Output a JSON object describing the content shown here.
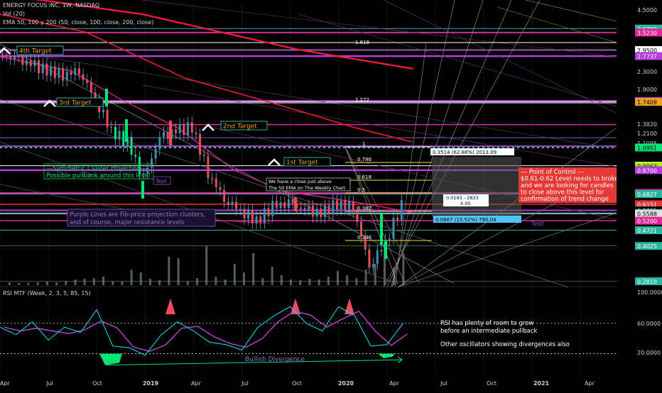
{
  "header": {
    "symbol_line": "ENERGY FOCUS INC, 1W, NASDAQ",
    "vol_line": "Vol (20)",
    "ema_line": "EMA 50, 100 y 200 (50, close, 100, close, 200, close)"
  },
  "price_axis_labels": [
    "4.5000",
    "3.6700",
    "3.5230",
    "2.9500",
    "2.7737",
    "2.3000",
    "1.9000",
    "1.7572",
    "1.7448",
    "1.7409",
    "1.3820",
    "1.2100",
    "1.1095",
    "1.0951",
    "0.9102",
    "0.9063",
    "0.8700",
    "0.6898",
    "0.6827",
    "0.6151",
    "0.5781",
    "0.5623",
    "0.5588",
    "0.5200",
    "0.4721",
    "0.4025",
    "0.2810"
  ],
  "rsi_axis_labels": [
    "100.0000",
    "60.0000",
    "20.0000"
  ],
  "time_labels": [
    "Apr",
    "Jul",
    "Oct",
    "2019",
    "Apr",
    "Jul",
    "Oct",
    "2020",
    "Apr",
    "Jul",
    "Oct",
    "2021",
    "Apr"
  ],
  "annotations": {
    "target4": "4th Target",
    "target3": "3rd Target",
    "target2": "2nd Target",
    "target1": "1st Target",
    "cluster1": "---Symmetric Cluster Projection---",
    "cluster2": "Possible pullback around this level",
    "text_small": "Text",
    "text_blue": "Text",
    "purple1": "Purple Lines are Fib-price projection clusters,",
    "purple2": "and of course, major resistance levels",
    "close1": "We have a close just above",
    "close2": "The 50 EMA on The Weekly Chart",
    "poc1": "--- Point of Control ---",
    "poc2": "$0.61-0.62  Level needs to broken",
    "poc3": "and we are looking for candles",
    "poc4": "to close above this level for",
    "poc5": "confirmation of trend change",
    "fib_1618": "1.618",
    "fib_1272": "1.272",
    "fib_0382_right": "0.382",
    "fib_0236_right": "0.236",
    "fib_zero_right": "0",
    "fib_1": "1",
    "fib_0786": "0.786",
    "fib_0618": "0.618",
    "fib_05": "0.5",
    "fib_0382": "0.382",
    "fib_0236": "0.236",
    "measure1": "0.3514 (62.88%) 2013.09",
    "measure2a": "0.0193 - 2833",
    "measure2b": "4.05",
    "measure3": "0.0867 (15.52%) 790.04"
  },
  "rsi": {
    "title": "RSI MTF (Week, 2, 3, 5, 85, 15)",
    "divergence_label": "Bullish Divergence",
    "note1": "RSI has plenty of room to grow",
    "note2": "before an intermediate pullback",
    "note3": "Other oscillators showing divergences also"
  },
  "colors": {
    "background": "#000000",
    "up_candle": "#53b987",
    "down_candle": "#eb4d5c",
    "bright_green": "#00e676",
    "purple_level": "#b43cdc",
    "magenta_level": "#e0279a",
    "ema50": "#e0279a",
    "ema100": "#e91e2e",
    "ema200": "#ff1744",
    "rsi_fast": "#00e5ff",
    "rsi_slow": "#c040d0",
    "poc_box": "#e53935"
  },
  "chart_data": [
    {
      "type": "candlestick",
      "title": "ENERGY FOCUS INC, 1W, NASDAQ",
      "y_scale": "log",
      "ylim": [
        0.28,
        4.5
      ],
      "x_range": [
        "2018-04",
        "2021-05"
      ],
      "price_path": [
        {
          "date": "2018-04",
          "close": 2.85
        },
        {
          "date": "2018-05",
          "close": 2.7
        },
        {
          "date": "2018-06",
          "close": 2.55
        },
        {
          "date": "2018-07",
          "close": 2.4
        },
        {
          "date": "2018-08",
          "close": 2.3
        },
        {
          "date": "2018-09",
          "close": 2.4
        },
        {
          "date": "2018-10",
          "close": 1.8
        },
        {
          "date": "2018-11",
          "close": 1.3
        },
        {
          "date": "2018-12",
          "close": 1.15
        },
        {
          "date": "2019-01",
          "close": 0.8
        },
        {
          "date": "2019-02",
          "close": 1.2
        },
        {
          "date": "2019-03",
          "close": 1.3
        },
        {
          "date": "2019-04",
          "close": 1.35
        },
        {
          "date": "2019-05",
          "close": 0.85
        },
        {
          "date": "2019-06",
          "close": 0.65
        },
        {
          "date": "2019-07",
          "close": 0.58
        },
        {
          "date": "2019-08",
          "close": 0.52
        },
        {
          "date": "2019-09",
          "close": 0.6
        },
        {
          "date": "2019-10",
          "close": 0.62
        },
        {
          "date": "2019-11",
          "close": 0.58
        },
        {
          "date": "2019-12",
          "close": 0.56
        },
        {
          "date": "2020-01",
          "close": 0.62
        },
        {
          "date": "2020-02",
          "close": 0.6
        },
        {
          "date": "2020-03",
          "close": 0.33
        },
        {
          "date": "2020-04",
          "close": 0.42
        },
        {
          "date": "2020-05",
          "close": 0.61
        }
      ],
      "horizontal_levels": [
        3.67,
        3.523,
        2.95,
        2.7737,
        1.7572,
        1.7448,
        1.7409,
        1.382,
        1.21,
        1.1095,
        1.0951,
        0.9102,
        0.9063,
        0.87,
        0.6898,
        0.6827,
        0.6151,
        0.5781,
        0.5623,
        0.5588,
        0.52,
        0.4721,
        0.4025,
        0.281
      ],
      "series": [
        {
          "name": "EMA 50"
        },
        {
          "name": "EMA 100"
        },
        {
          "name": "EMA 200"
        }
      ]
    },
    {
      "type": "line",
      "title": "RSI MTF (Week, 2, 3, 5, 85, 15)",
      "ylim": [
        0,
        100
      ],
      "yticks": [
        20,
        60,
        100
      ],
      "x": [
        "2018-04",
        "2018-05",
        "2018-06",
        "2018-07",
        "2018-08",
        "2018-09",
        "2018-10",
        "2018-11",
        "2018-12",
        "2019-01",
        "2019-02",
        "2019-03",
        "2019-04",
        "2019-05",
        "2019-06",
        "2019-07",
        "2019-08",
        "2019-09",
        "2019-10",
        "2019-11",
        "2019-12",
        "2020-01",
        "2020-02",
        "2020-03",
        "2020-04",
        "2020-05"
      ],
      "series": [
        {
          "values": [
            55,
            45,
            62,
            38,
            55,
            48,
            78,
            30,
            28,
            18,
            45,
            62,
            50,
            35,
            32,
            25,
            55,
            70,
            82,
            60,
            50,
            82,
            70,
            30,
            32,
            60
          ]
        }
      ]
    }
  ]
}
